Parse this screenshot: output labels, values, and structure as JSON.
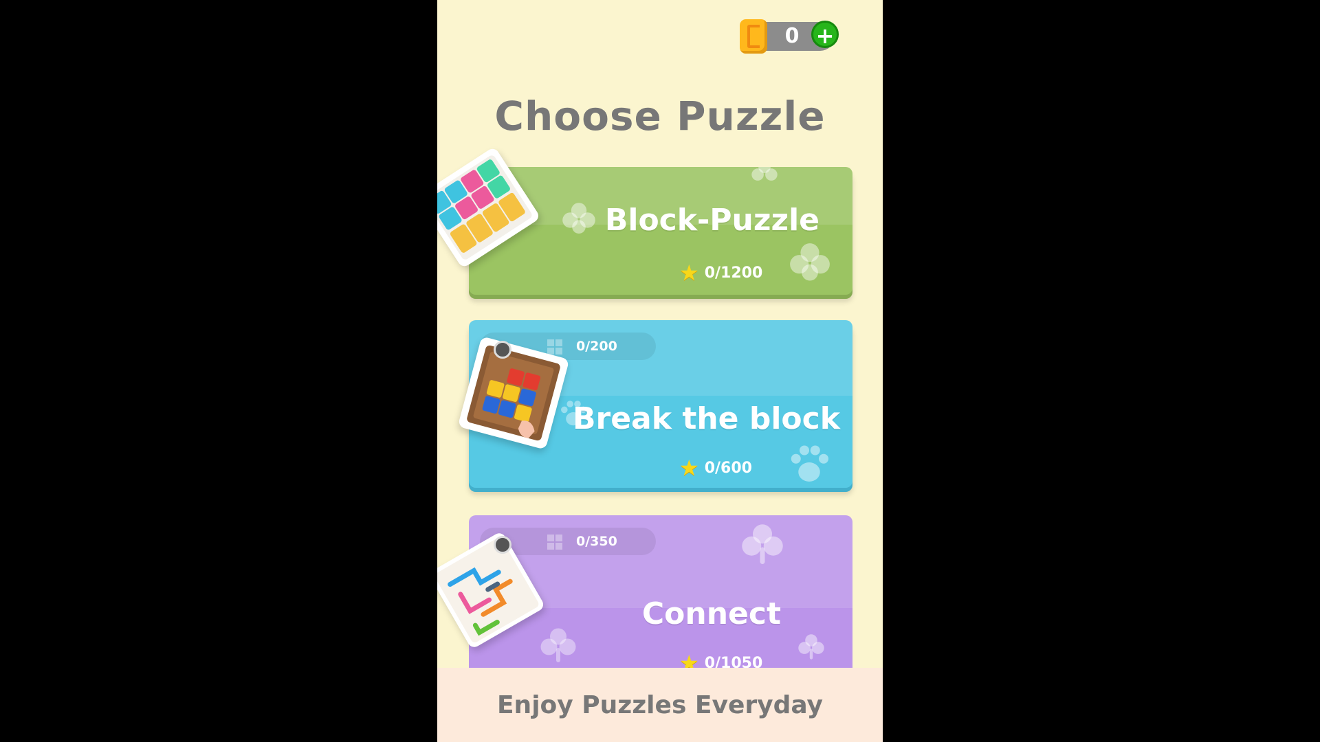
{
  "header": {
    "coin_count": "0",
    "coin_icon": "coin-icon",
    "add_icon": "plus-icon"
  },
  "title": "Choose Puzzle",
  "puzzles": [
    {
      "name": "Block-Puzzle",
      "stars": "0/1200",
      "color": "#9bc462"
    },
    {
      "name": "Break the block",
      "progress": "0/200",
      "stars": "0/600",
      "color": "#56c9e4"
    },
    {
      "name": "Connect",
      "progress": "0/350",
      "stars": "0/1050",
      "color": "#bb94ea"
    }
  ],
  "footer": {
    "tagline": "Enjoy Puzzles Everyday"
  }
}
